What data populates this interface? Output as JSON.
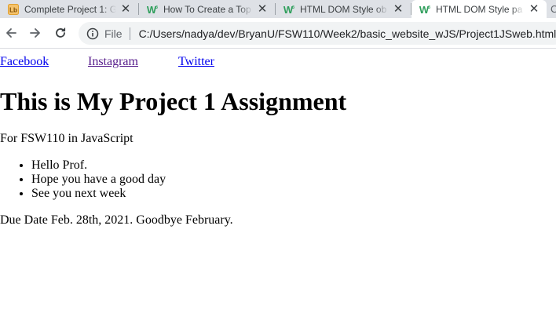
{
  "browser": {
    "tabs": [
      {
        "title": "Complete Project 1: G",
        "favicon": "lb-icon"
      },
      {
        "title": "How To Create a Top",
        "favicon": "w3schools-icon"
      },
      {
        "title": "HTML DOM Style ob",
        "favicon": "w3schools-icon"
      },
      {
        "title": "HTML DOM Style pa",
        "favicon": "w3schools-icon"
      }
    ],
    "overflow_tab_glyph": "C",
    "address": {
      "scheme_label": "File",
      "url": "C:/Users/nadya/dev/BryanU/FSW110/Week2/basic_website_wJS/Project1JSweb.html"
    }
  },
  "page": {
    "nav_links": [
      {
        "label": "Facebook"
      },
      {
        "label": "Instagram"
      },
      {
        "label": "Twitter"
      }
    ],
    "heading": "This is My Project 1 Assignment",
    "subtitle": "For FSW110 in JavaScript",
    "list_items": [
      "Hello Prof.",
      "Hope you have a good day",
      "See you next week"
    ],
    "due_date": "Due Date Feb. 28th, 2021. Goodbye February."
  }
}
